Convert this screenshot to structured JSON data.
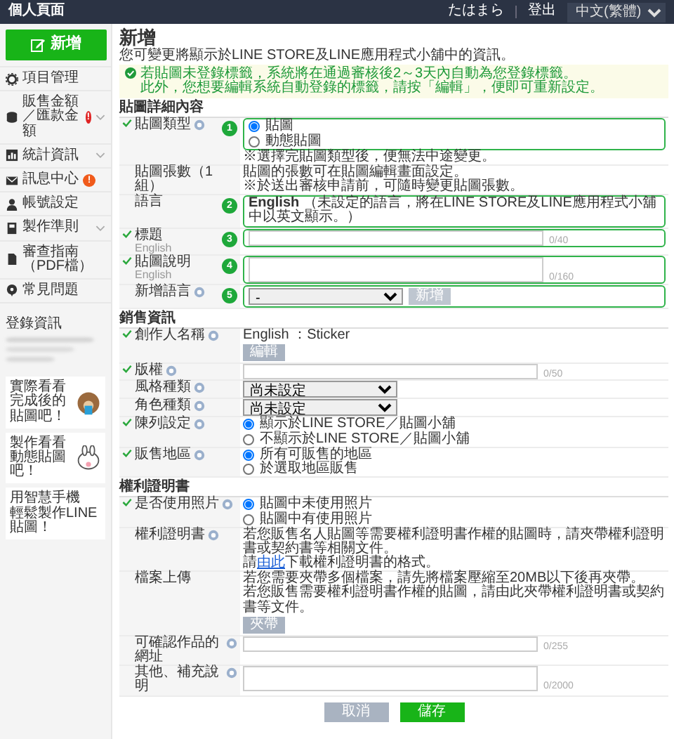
{
  "header": {
    "title": "個人頁面",
    "user": "たはまら",
    "logout": "登出",
    "language": "中文(繁體)"
  },
  "sidebar": {
    "new_button": "新增",
    "items": [
      {
        "label": "項目管理",
        "expandable": false
      },
      {
        "label": "販售金額／匯款金額",
        "expandable": true,
        "badge": {
          "text": "!",
          "color": "#e02424"
        }
      },
      {
        "label": "統計資訊",
        "expandable": true
      },
      {
        "label": "訊息中心",
        "expandable": false,
        "badge": {
          "text": "!",
          "color": "#f05a1a"
        }
      },
      {
        "label": "帳號設定",
        "expandable": false
      },
      {
        "label": "製作準則",
        "expandable": true
      },
      {
        "label": "審查指南（PDF檔）",
        "expandable": false
      },
      {
        "label": "常見問題",
        "expandable": false
      }
    ],
    "login_heading": "登錄資訊",
    "promos": [
      {
        "lines": [
          "實際看看",
          "完成後的貼圖吧！"
        ]
      },
      {
        "lines": [
          "製作看看",
          "動態貼圖吧！"
        ]
      },
      {
        "lines": [
          "用智慧手機",
          "輕鬆製作LINE貼圖！"
        ]
      }
    ]
  },
  "page": {
    "title": "新增",
    "description": "您可變更將顯示於LINE STORE及LINE應用程式小舖中的資訊。",
    "notice": [
      "若貼圖未登錄標籤，系統將在通過審核後2～3天內自動為您登錄標籤。",
      "此外，您想要編輯系統自動登錄的標籤，請按「編輯」，便即可重新設定。"
    ]
  },
  "sections": [
    {
      "title": "貼圖詳細內容",
      "rows": [
        {
          "kind": "radio",
          "label": "貼圖類型",
          "checked": true,
          "help": true,
          "step": "1",
          "options": [
            {
              "label": "貼圖",
              "selected": true
            },
            {
              "label": "動態貼圖",
              "selected": false
            }
          ],
          "note": "※選擇完貼圖類型後，便無法中途變更。"
        },
        {
          "kind": "text",
          "label": "貼圖張數（1組）",
          "checked": false,
          "help": false,
          "lines": [
            "貼圖的張數可在貼圖編輯畫面設定。",
            "※於送出審核申請前，可隨時變更貼圖張數。"
          ]
        },
        {
          "kind": "text",
          "label": "語言",
          "checked": false,
          "help": false,
          "step": "2",
          "lines": [
            "**English** （未設定的語言，將在LINE STORE及LINE應用程式小舖中以英文顯示。）"
          ]
        },
        {
          "kind": "input",
          "label": "標題",
          "sub": "English",
          "checked": true,
          "help": false,
          "step": "3",
          "counter": "0/40"
        },
        {
          "kind": "textarea",
          "label": "貼圖說明",
          "sub": "English",
          "checked": true,
          "help": false,
          "step": "4",
          "counter": "0/160"
        },
        {
          "kind": "select-add",
          "label": "新增語言",
          "checked": false,
          "help": true,
          "step": "5",
          "value": "-",
          "button": "新增",
          "button_disabled": true
        }
      ]
    },
    {
      "title": "銷售資訊",
      "rows": [
        {
          "kind": "creator",
          "label": "創作人名稱",
          "checked": true,
          "help": true,
          "lines": [
            "English ：Sticker"
          ],
          "button": "編輯"
        },
        {
          "kind": "input",
          "label": "版權",
          "checked": true,
          "help": true,
          "counter": "0/50"
        },
        {
          "kind": "select",
          "label": "風格種類",
          "checked": false,
          "help": true,
          "value": "尚未設定"
        },
        {
          "kind": "select",
          "label": "角色種類",
          "checked": false,
          "help": true,
          "value": "尚未設定"
        },
        {
          "kind": "radio",
          "label": "陳列設定",
          "checked": true,
          "help": true,
          "options": [
            {
              "label": "顯示於LINE STORE／貼圖小舖",
              "selected": true
            },
            {
              "label": "不顯示於LINE STORE／貼圖小舖",
              "selected": false
            }
          ]
        },
        {
          "kind": "radio",
          "label": "販售地區",
          "checked": true,
          "help": true,
          "options": [
            {
              "label": "所有可販售的地區",
              "selected": true
            },
            {
              "label": "於選取地區販售",
              "selected": false
            }
          ]
        }
      ]
    },
    {
      "title": "權利證明書",
      "rows": [
        {
          "kind": "radio",
          "label": "是否使用照片",
          "checked": true,
          "help": true,
          "options": [
            {
              "label": "貼圖中未使用照片",
              "selected": true
            },
            {
              "label": "貼圖中有使用照片",
              "selected": false
            }
          ]
        },
        {
          "kind": "link-text",
          "label": "權利證明書",
          "checked": false,
          "help": true,
          "lines": [
            "若您販售名人貼圖等需要權利證明書作權的貼圖時，請夾帶權利證明書或契約書等相關文件。"
          ],
          "link_line": {
            "before": "請",
            "link": "由此",
            "after": "下載權利證明書的格式。"
          }
        },
        {
          "kind": "upload",
          "label": "檔案上傳",
          "checked": false,
          "help": false,
          "lines": [
            "若您需要夾帶多個檔案，請先將檔案壓縮至20MB以下後再夾帶。",
            "若您販售需要權利證明書作權的貼圖，請由此夾帶權利證明書或契約書等文件。"
          ],
          "button": "夾帶"
        },
        {
          "kind": "input",
          "label": "可確認作品的網址",
          "checked": false,
          "help": true,
          "counter": "0/255"
        },
        {
          "kind": "textarea",
          "label": "其他、補充說明",
          "checked": false,
          "help": true,
          "counter": "0/2000"
        }
      ]
    }
  ],
  "footer_buttons": [
    {
      "label": "取消",
      "kind": "secondary"
    },
    {
      "label": "儲存",
      "kind": "primary"
    }
  ]
}
